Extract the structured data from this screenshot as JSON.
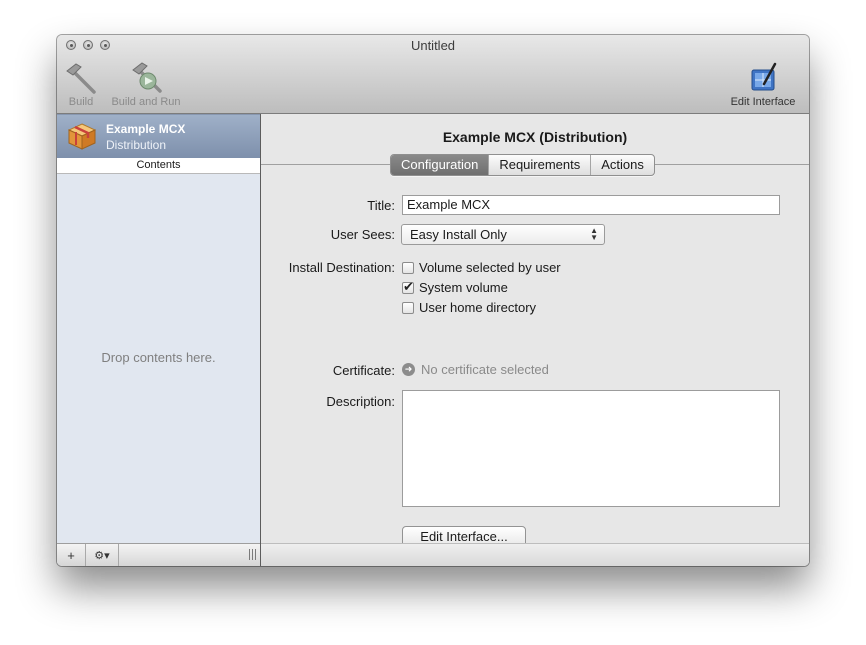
{
  "window": {
    "title": "Untitled"
  },
  "toolbar": {
    "build_label": "Build",
    "build_and_run_label": "Build and Run",
    "edit_interface_label": "Edit Interface"
  },
  "sidebar": {
    "selected_item": {
      "name": "Example MCX",
      "subtitle": "Distribution"
    },
    "contents_header": "Contents",
    "drop_hint": "Drop contents here.",
    "add_symbol": "+",
    "action_symbol": "⚙▾"
  },
  "main": {
    "title": "Example MCX (Distribution)",
    "tabs": [
      {
        "label": "Configuration",
        "active": true
      },
      {
        "label": "Requirements",
        "active": false
      },
      {
        "label": "Actions",
        "active": false
      }
    ],
    "form": {
      "title_label": "Title:",
      "title_value": "Example MCX",
      "user_sees_label": "User Sees:",
      "user_sees_value": "Easy Install Only",
      "install_destination_label": "Install Destination:",
      "destinations": [
        {
          "label": "Volume selected by user",
          "checked": false
        },
        {
          "label": "System volume",
          "checked": true
        },
        {
          "label": "User home directory",
          "checked": false
        }
      ],
      "certificate_label": "Certificate:",
      "certificate_value": "No certificate selected",
      "description_label": "Description:",
      "description_value": "",
      "edit_interface_button": "Edit Interface..."
    }
  },
  "colors": {
    "selection": "#8a9bb6",
    "sidebar_bg": "#e1e7f0",
    "active_tab": "#7c7c7c"
  }
}
